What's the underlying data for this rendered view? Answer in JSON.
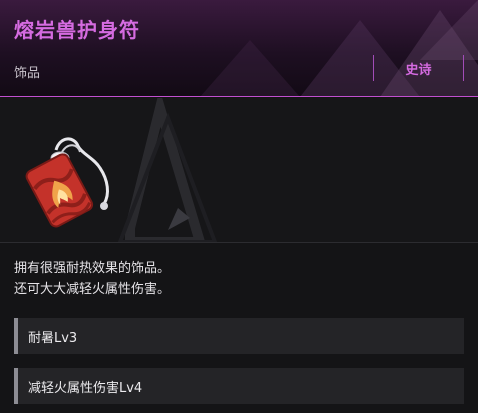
{
  "item": {
    "name": "熔岩兽护身符",
    "category": "饰品",
    "rarity": "史诗",
    "description_lines": [
      "拥有很强耐热效果的饰品。",
      "还可大大减轻火属性伤害。"
    ],
    "stats": [
      "耐暑Lv3",
      "减轻火属性伤害Lv4"
    ]
  },
  "colors": {
    "rarity_accent": "#d56be0",
    "header_line": "#c24fd0",
    "charm_red": "#c4322a",
    "flame_orange": "#f0a34a"
  },
  "icons": {
    "item": "fire-charm-icon"
  }
}
